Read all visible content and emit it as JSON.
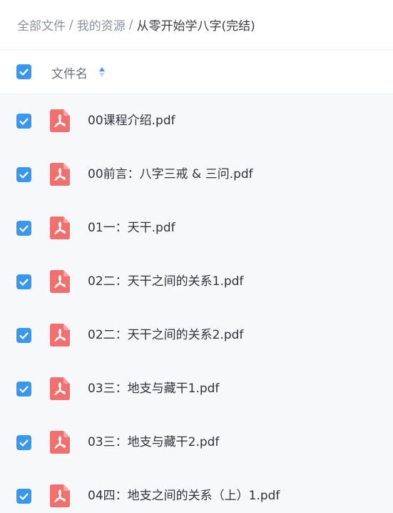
{
  "breadcrumb": {
    "items": [
      "全部文件",
      "我的资源"
    ],
    "separator": "/",
    "current": "从零开始学八字(完结)"
  },
  "header": {
    "column_title": "文件名",
    "select_all_checked": true
  },
  "files": [
    {
      "name": "00课程介绍.pdf",
      "checked": true,
      "icon": "pdf-icon"
    },
    {
      "name": "00前言：八字三戒 & 三问.pdf",
      "checked": true,
      "icon": "pdf-icon"
    },
    {
      "name": "01一：天干.pdf",
      "checked": true,
      "icon": "pdf-icon"
    },
    {
      "name": "02二：天干之间的关系1.pdf",
      "checked": true,
      "icon": "pdf-icon"
    },
    {
      "name": "02二：天干之间的关系2.pdf",
      "checked": true,
      "icon": "pdf-icon"
    },
    {
      "name": "03三：地支与藏干1.pdf",
      "checked": true,
      "icon": "pdf-icon"
    },
    {
      "name": "03三：地支与藏干2.pdf",
      "checked": true,
      "icon": "pdf-icon"
    },
    {
      "name": "04四：地支之间的关系（上）1.pdf",
      "checked": true,
      "icon": "pdf-icon"
    }
  ],
  "colors": {
    "accent": "#3a97ee",
    "pdf_icon": "#f0706f"
  }
}
